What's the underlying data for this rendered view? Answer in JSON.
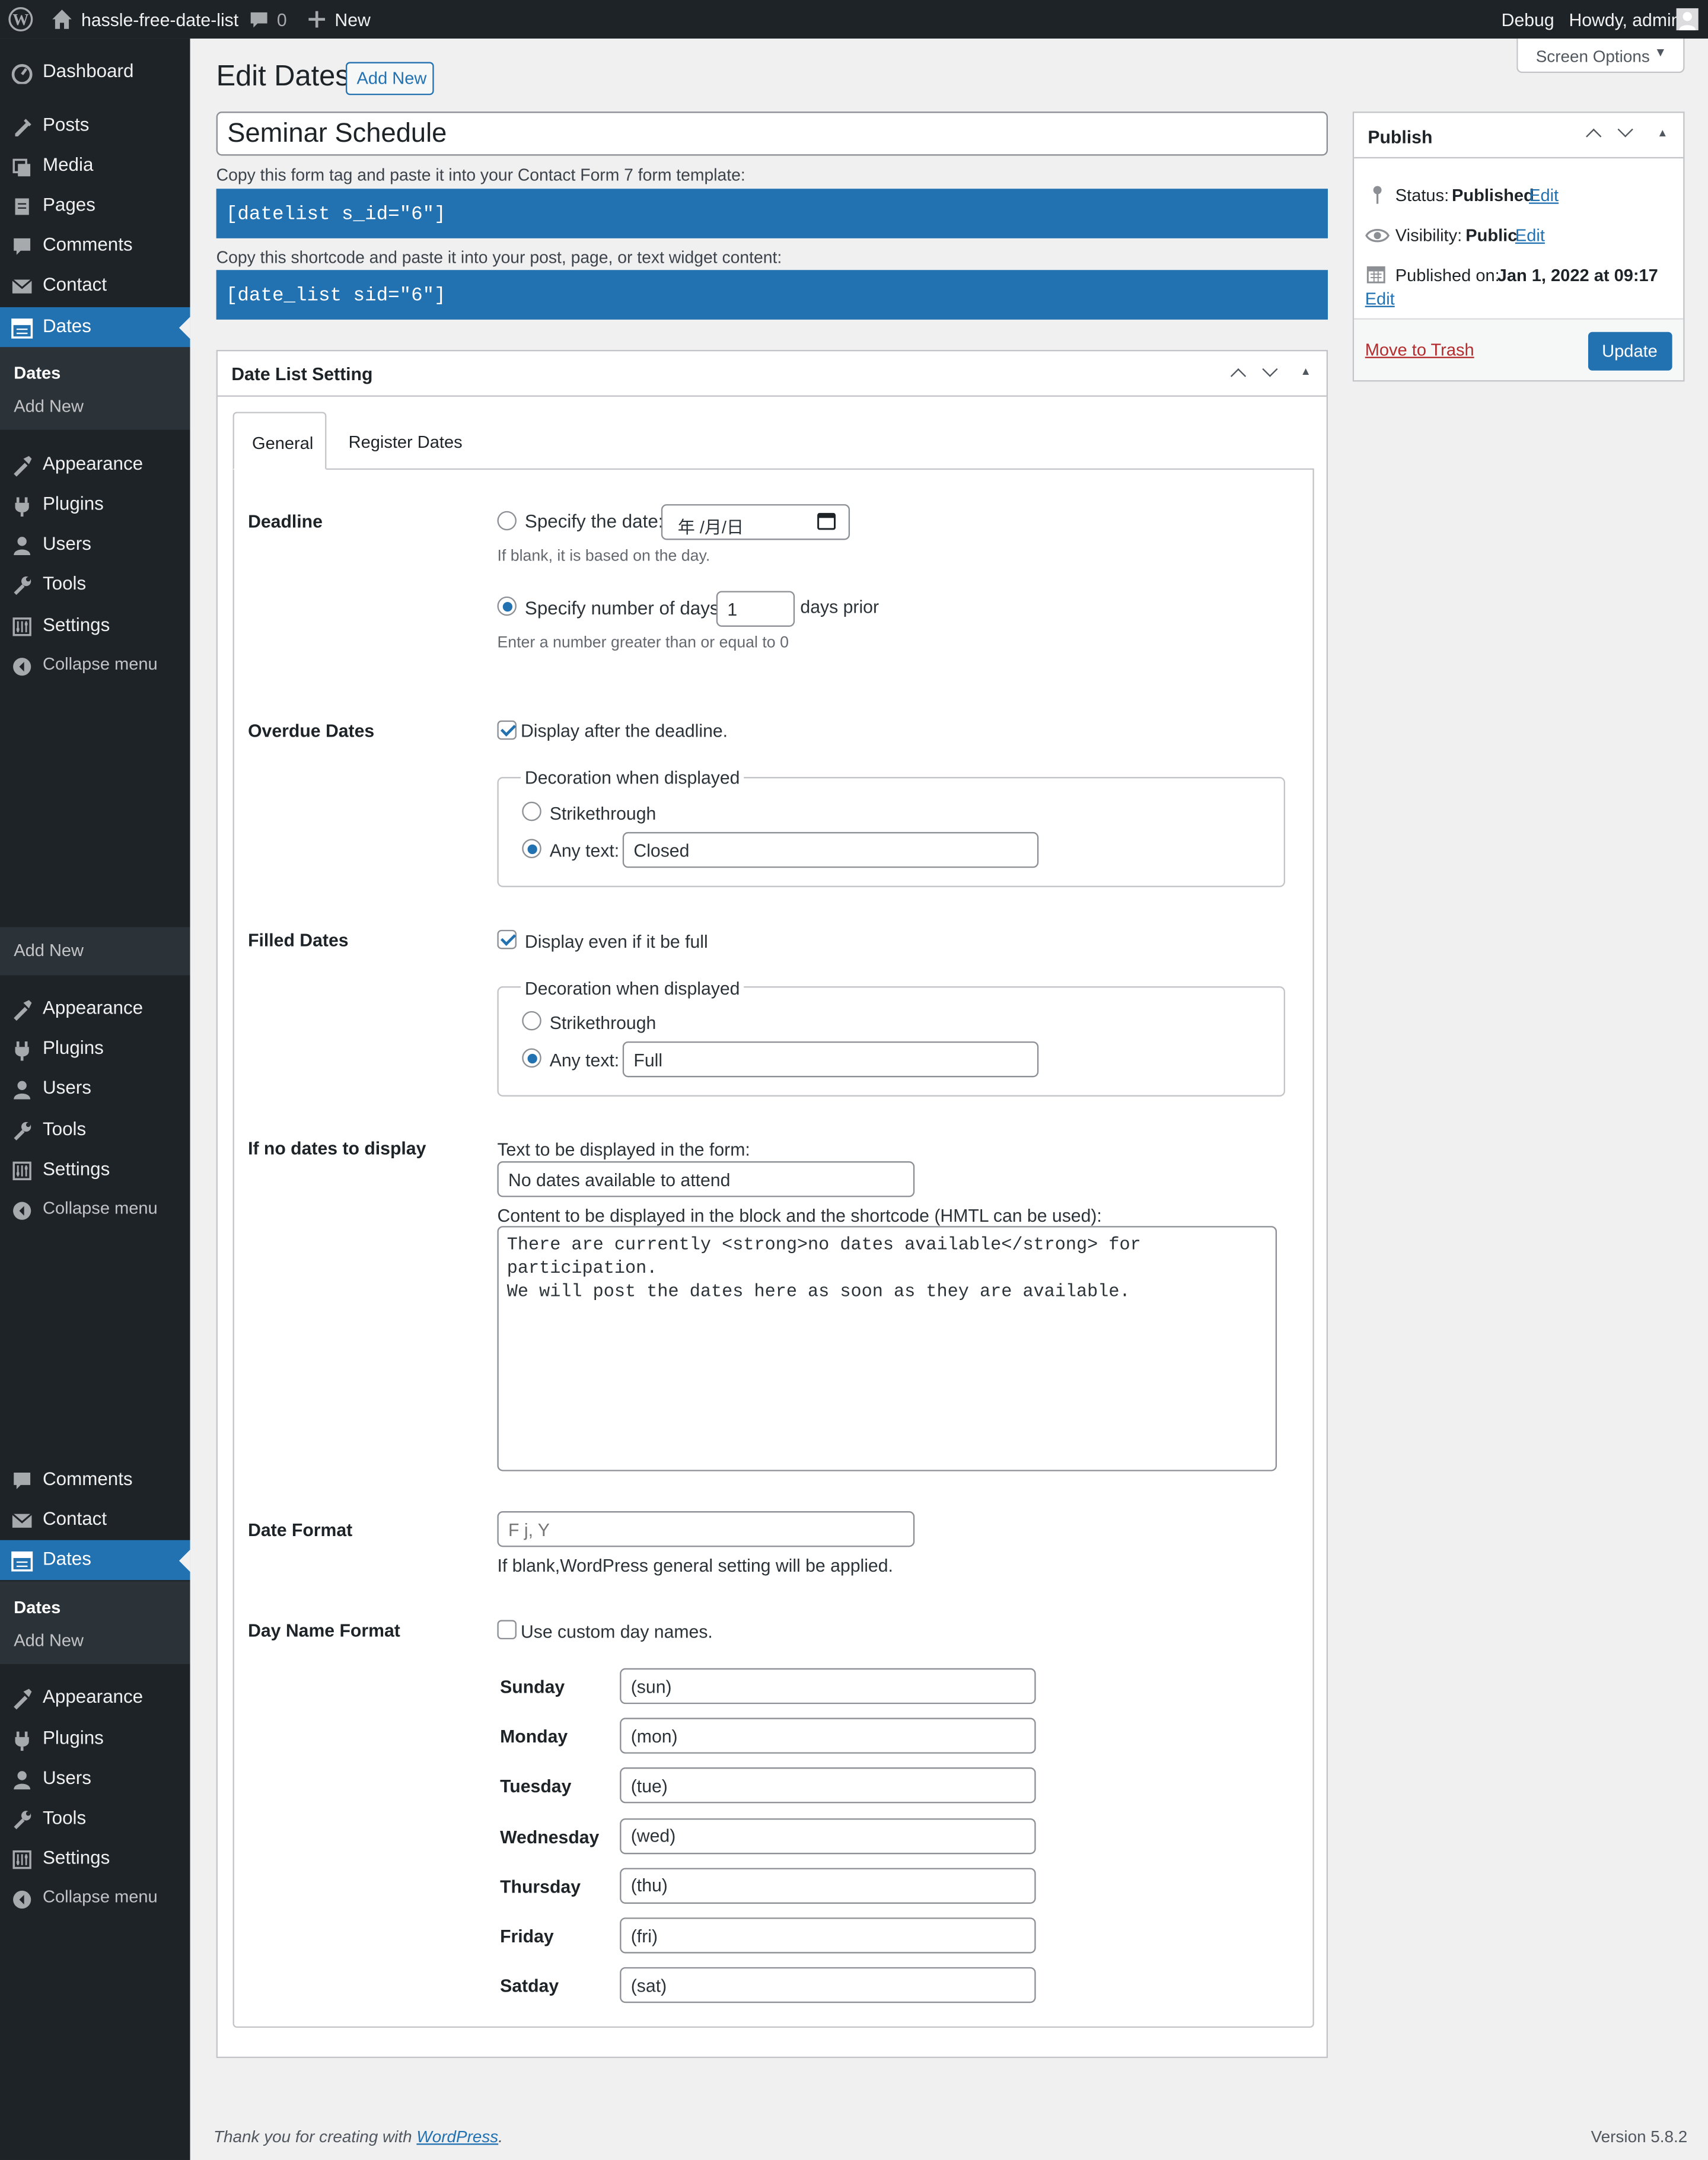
{
  "admin_bar": {
    "site_name": "hassle-free-date-list",
    "comments_count": "0",
    "new_label": "New",
    "debug_label": "Debug",
    "howdy": "Howdy, admin"
  },
  "sidebar": {
    "block1": {
      "items": [
        "Dashboard",
        "Posts",
        "Media",
        "Pages",
        "Comments",
        "Contact",
        "Dates"
      ],
      "submenu": [
        "Dates",
        "Add New"
      ],
      "items2": [
        "Appearance",
        "Plugins",
        "Users",
        "Tools",
        "Settings"
      ],
      "collapse": "Collapse menu"
    },
    "block2": {
      "submenu": [
        "Add New"
      ],
      "items2": [
        "Appearance",
        "Plugins",
        "Users",
        "Tools",
        "Settings"
      ],
      "collapse": "Collapse menu"
    },
    "block3": {
      "items": [
        "Comments",
        "Contact",
        "Dates"
      ],
      "submenu": [
        "Dates",
        "Add New"
      ],
      "items2": [
        "Appearance",
        "Plugins",
        "Users",
        "Tools",
        "Settings"
      ],
      "collapse": "Collapse menu"
    }
  },
  "screen_options": "Screen Options",
  "page_title": "Edit Dates",
  "add_new_button": "Add New",
  "post_title": "Seminar Schedule",
  "form_tag_hint": "Copy this form tag and paste it into your Contact Form 7 form template:",
  "form_tag": "[datelist s_id=\"6\"]",
  "shortcode_hint": "Copy this shortcode and paste it into your post, page, or text widget content:",
  "shortcode": "[date_list sid=\"6\"]",
  "publish": {
    "title": "Publish",
    "status_label": "Status:",
    "status_value": "Published",
    "visibility_label": "Visibility:",
    "visibility_value": "Public",
    "published_label": "Published on:",
    "published_value": "Jan 1, 2022 at 09:17",
    "edit_link": "Edit",
    "trash": "Move to Trash",
    "update": "Update"
  },
  "settings_box": {
    "title": "Date List Setting",
    "tabs": [
      "General",
      "Register Dates"
    ],
    "active_tab": "General"
  },
  "deadline": {
    "heading": "Deadline",
    "specify_date_label": "Specify the date:",
    "date_placeholder": "年 /月/日",
    "date_hint": "If blank, it is based on the day.",
    "specify_days_label": "Specify number of days:",
    "days_value": "1",
    "days_suffix": "days prior",
    "days_hint": "Enter a number greater than or equal to 0",
    "selected": "days"
  },
  "overdue": {
    "heading": "Overdue Dates",
    "checkbox_label": "Display after the deadline.",
    "checked": true,
    "legend": "Decoration when displayed",
    "strike_label": "Strikethrough",
    "text_label": "Any text:",
    "text_value": "Closed",
    "selected": "text"
  },
  "filled": {
    "heading": "Filled Dates",
    "checkbox_label": "Display even if it be full",
    "checked": true,
    "legend": "Decoration when displayed",
    "strike_label": "Strikethrough",
    "text_label": "Any text:",
    "text_value": "Full",
    "selected": "text"
  },
  "no_dates": {
    "heading": "If no dates to display",
    "form_text_label": "Text to be displayed in the form:",
    "form_text_value": "No dates available to attend",
    "content_label": "Content to be displayed in the block and the shortcode (HMTL can be used):",
    "content_value": "There are currently <strong>no dates available</strong> for participation.\nWe will post the dates here as soon as they are available."
  },
  "date_format": {
    "heading": "Date Format",
    "placeholder": "F j, Y",
    "hint": "If blank,WordPress general setting will be applied."
  },
  "day_names": {
    "heading": "Day Name Format",
    "checkbox_label": "Use custom day names.",
    "checked": false,
    "days": [
      {
        "label": "Sunday",
        "value": "(sun)"
      },
      {
        "label": "Monday",
        "value": "(mon)"
      },
      {
        "label": "Tuesday",
        "value": "(tue)"
      },
      {
        "label": "Wednesday",
        "value": "(wed)"
      },
      {
        "label": "Thursday",
        "value": "(thu)"
      },
      {
        "label": "Friday",
        "value": "(fri)"
      },
      {
        "label": "Satday",
        "value": "(sat)"
      }
    ]
  },
  "footer": {
    "thanks_prefix": "Thank you for creating with",
    "wordpress_link": "WordPress",
    "thanks_suffix": ".",
    "version": "Version 5.8.2"
  },
  "colors": {
    "admin_dark": "#1d2327",
    "accent": "#2271b1",
    "page_bg": "#f0f0f1"
  }
}
